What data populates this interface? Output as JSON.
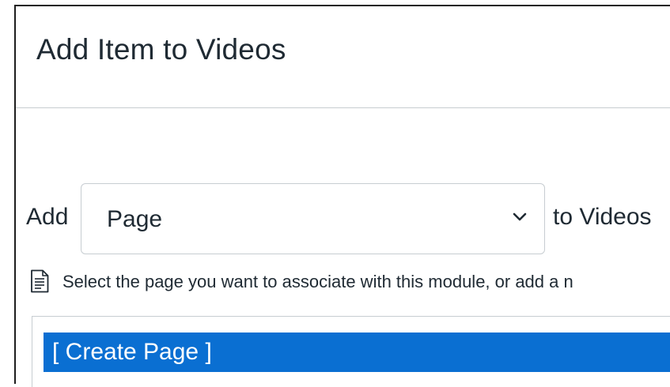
{
  "dialog": {
    "title": "Add Item to Videos"
  },
  "add_row": {
    "add_label": "Add",
    "selected_type": "Page",
    "to_label": "to Videos"
  },
  "hint": {
    "icon": "page-icon",
    "text": "Select the page you want to associate with this module, or add a n"
  },
  "page_list": {
    "options": [
      {
        "label": "[ Create Page ]",
        "selected": true
      }
    ]
  },
  "colors": {
    "selection": "#0a6fd2",
    "text": "#1f2a33",
    "border": "#c7cdd1"
  }
}
